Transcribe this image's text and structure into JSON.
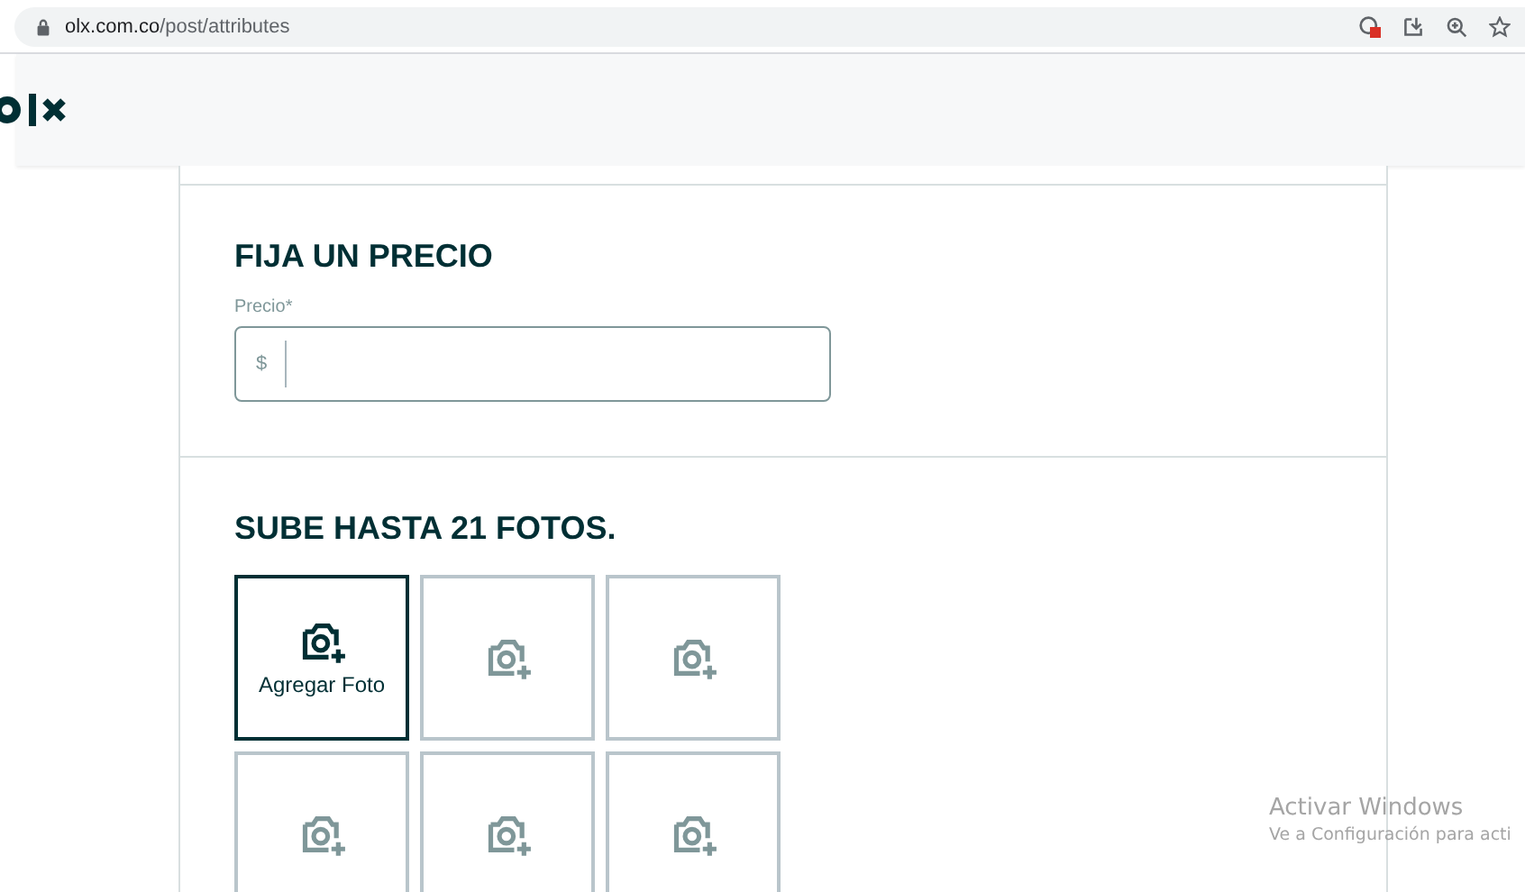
{
  "browser": {
    "url_host": "olx.com.co",
    "url_path": "/post/attributes"
  },
  "price_section": {
    "title": "FIJA UN PRECIO",
    "field": {
      "label": "Precio*",
      "prefix": "$"
    }
  },
  "photos_section": {
    "title": "SUBE HASTA 21 FOTOS.",
    "slots": [
      {
        "kind": "add",
        "label": "Agregar Foto"
      },
      {
        "kind": "empty"
      },
      {
        "kind": "empty"
      },
      {
        "kind": "empty"
      },
      {
        "kind": "empty"
      },
      {
        "kind": "empty"
      }
    ]
  },
  "os_notice": {
    "title": "Activar Windows",
    "text": "Ve a Configuración para acti"
  }
}
